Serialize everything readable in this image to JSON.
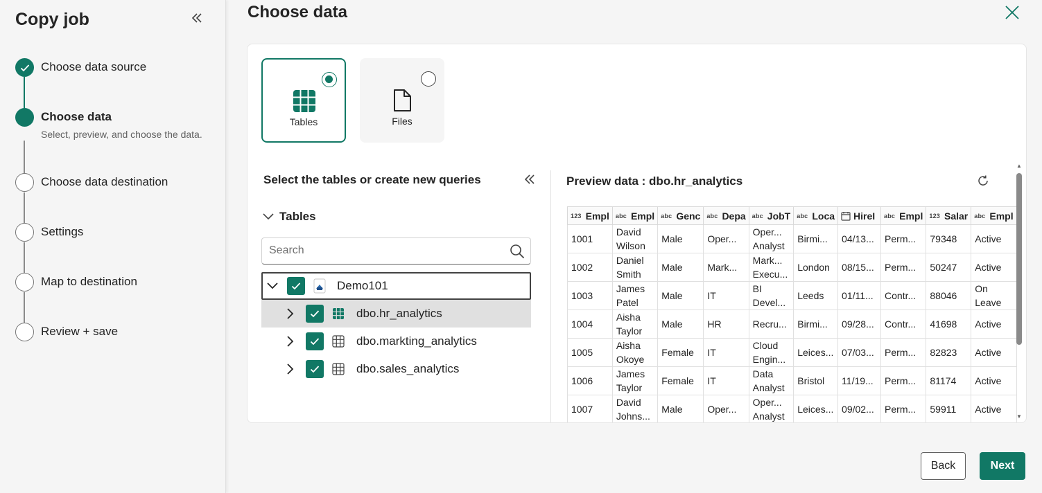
{
  "sidebar": {
    "title": "Copy job",
    "steps": [
      {
        "label": "Choose data source",
        "state": "done"
      },
      {
        "label": "Choose data",
        "sub": "Select, preview, and choose the data.",
        "state": "current"
      },
      {
        "label": "Choose data destination",
        "state": "pending"
      },
      {
        "label": "Settings",
        "state": "pending"
      },
      {
        "label": "Map to destination",
        "state": "pending"
      },
      {
        "label": "Review + save",
        "state": "pending"
      }
    ]
  },
  "main": {
    "title": "Choose data",
    "source_types": [
      {
        "label": "Tables",
        "selected": true,
        "icon": "table-icon"
      },
      {
        "label": "Files",
        "selected": false,
        "icon": "file-icon"
      }
    ]
  },
  "tree": {
    "header": "Select the tables or create new queries",
    "section_label": "Tables",
    "search_placeholder": "Search",
    "root": {
      "label": "Demo101",
      "icon": "lakehouse-icon",
      "checked": true,
      "expanded": true
    },
    "items": [
      {
        "label": "dbo.hr_analytics",
        "checked": true,
        "selected": true
      },
      {
        "label": "dbo.markting_analytics",
        "checked": true,
        "selected": false
      },
      {
        "label": "dbo.sales_analytics",
        "checked": true,
        "selected": false
      }
    ]
  },
  "preview": {
    "title": "Preview data : dbo.hr_analytics",
    "columns": [
      {
        "type": "123",
        "name": "Empl"
      },
      {
        "type": "abc",
        "name": "Empl"
      },
      {
        "type": "abc",
        "name": "Genc"
      },
      {
        "type": "abc",
        "name": "Depa"
      },
      {
        "type": "abc",
        "name": "JobT"
      },
      {
        "type": "abc",
        "name": "Loca"
      },
      {
        "type": "date",
        "name": "HireI"
      },
      {
        "type": "abc",
        "name": "Empl"
      },
      {
        "type": "123",
        "name": "Salar"
      },
      {
        "type": "abc",
        "name": "Empl"
      }
    ],
    "rows": [
      [
        "1001",
        "David Wilson",
        "Male",
        "Oper...",
        "Oper... Analyst",
        "Birmi...",
        "04/13...",
        "Perm...",
        "79348",
        "Active"
      ],
      [
        "1002",
        "Daniel Smith",
        "Male",
        "Mark...",
        "Mark... Execu...",
        "London",
        "08/15...",
        "Perm...",
        "50247",
        "Active"
      ],
      [
        "1003",
        "James Patel",
        "Male",
        "IT",
        "BI Devel...",
        "Leeds",
        "01/11...",
        "Contr...",
        "88046",
        "On Leave"
      ],
      [
        "1004",
        "Aisha Taylor",
        "Male",
        "HR",
        "Recru...",
        "Birmi...",
        "09/28...",
        "Contr...",
        "41698",
        "Active"
      ],
      [
        "1005",
        "Aisha Okoye",
        "Female",
        "IT",
        "Cloud Engin...",
        "Leices...",
        "07/03...",
        "Perm...",
        "82823",
        "Active"
      ],
      [
        "1006",
        "James Taylor",
        "Female",
        "IT",
        "Data Analyst",
        "Bristol",
        "11/19...",
        "Perm...",
        "81174",
        "Active"
      ],
      [
        "1007",
        "David Johns...",
        "Male",
        "Oper...",
        "Oper... Analyst",
        "Leices...",
        "09/02...",
        "Perm...",
        "59911",
        "Active"
      ]
    ]
  },
  "footer": {
    "back_label": "Back",
    "next_label": "Next"
  },
  "colors": {
    "accent": "#117865"
  }
}
